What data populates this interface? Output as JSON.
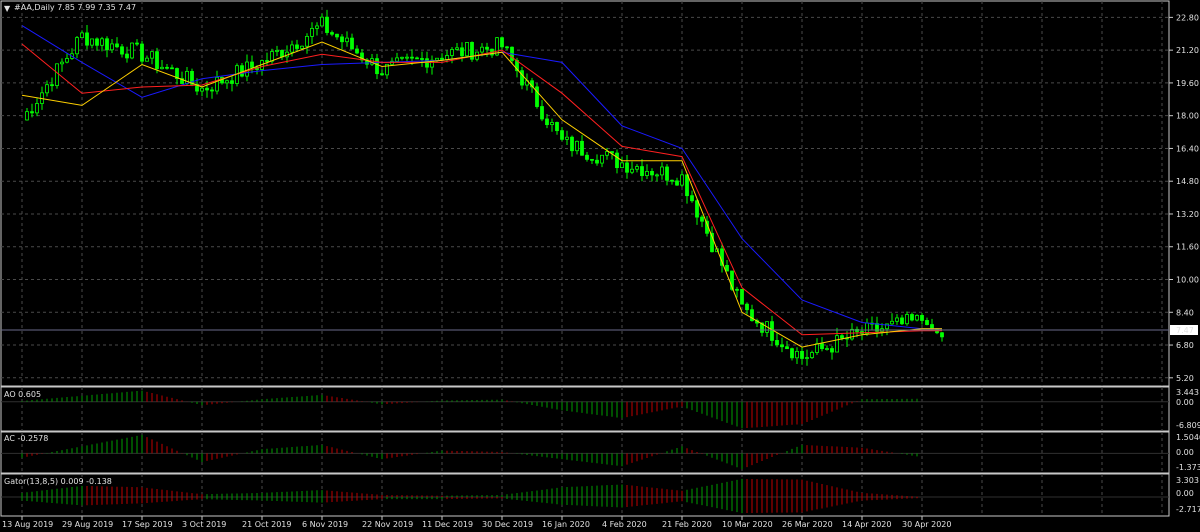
{
  "window": {
    "main_title": "#AA,Daily  7.85 7.99 7.35 7.47",
    "current_price": "7.47",
    "menu_arrow_icon": "triangle-down-icon"
  },
  "colors": {
    "background": "#000000",
    "grid": "#4a4a4a",
    "panel_border": "#c8c8c8",
    "bull": "#00ff00",
    "bear": "#00ff00",
    "jaw": "#1a1aff",
    "teeth": "#ff2020",
    "lips": "#ffd000",
    "ind_up": "#00a000",
    "ind_down": "#c00000",
    "text": "#e0e0e0"
  },
  "x_axis": {
    "labels": [
      "13 Aug 2019",
      "29 Aug 2019",
      "17 Sep 2019",
      "3 Oct 2019",
      "21 Oct 2019",
      "6 Nov 2019",
      "22 Nov 2019",
      "11 Dec 2019",
      "30 Dec 2019",
      "16 Jan 2020",
      "4 Feb 2020",
      "21 Feb 2020",
      "10 Mar 2020",
      "26 Mar 2020",
      "14 Apr 2020",
      "30 Apr 2020"
    ]
  },
  "main_panel": {
    "y_ticks": [
      "22.80",
      "21.20",
      "19.60",
      "18.00",
      "16.40",
      "14.80",
      "13.20",
      "11.60",
      "10.00",
      "8.40",
      "6.80",
      "5.20"
    ]
  },
  "ao_panel": {
    "title": "AO 0.605",
    "y_ticks": [
      "3.443",
      "0.00",
      "-6.809"
    ]
  },
  "ac_panel": {
    "title": "AC -0.2578",
    "y_ticks": [
      "1.5046",
      "0.00",
      "-1.3736"
    ]
  },
  "gator_panel": {
    "title": "Gator(13,8,5) 0.009 -0.138",
    "y_ticks": [
      "3.303",
      "0.00",
      "-2.717"
    ]
  },
  "chart_data": {
    "type": "line",
    "symbol": "#AA",
    "timeframe": "Daily",
    "last_bar": {
      "open": 7.85,
      "high": 7.99,
      "low": 7.35,
      "close": 7.47
    },
    "ylim": [
      4.8,
      23.6
    ],
    "x": [
      "13 Aug 2019",
      "29 Aug 2019",
      "17 Sep 2019",
      "3 Oct 2019",
      "21 Oct 2019",
      "6 Nov 2019",
      "22 Nov 2019",
      "11 Dec 2019",
      "30 Dec 2019",
      "16 Jan 2020",
      "4 Feb 2020",
      "21 Feb 2020",
      "10 Mar 2020",
      "26 Mar 2020",
      "14 Apr 2020",
      "30 Apr 2020"
    ],
    "series": [
      {
        "name": "Close",
        "values": [
          17.8,
          21.9,
          21.0,
          19.3,
          20.6,
          22.4,
          20.2,
          21.0,
          21.4,
          16.7,
          15.7,
          15.0,
          8.6,
          6.2,
          7.4,
          8.0
        ]
      },
      {
        "name": "Jaw",
        "values": [
          22.4,
          20.6,
          18.9,
          19.8,
          20.2,
          20.5,
          20.6,
          20.7,
          21.1,
          20.6,
          17.5,
          16.4,
          12.0,
          9.0,
          7.9,
          7.6
        ]
      },
      {
        "name": "Teeth",
        "values": [
          21.5,
          19.1,
          19.4,
          19.5,
          20.4,
          21.0,
          20.6,
          20.6,
          21.2,
          19.1,
          16.5,
          16.0,
          9.6,
          7.3,
          7.4,
          7.5
        ]
      },
      {
        "name": "Lips",
        "values": [
          19.0,
          18.5,
          20.5,
          19.4,
          20.5,
          21.6,
          20.4,
          20.7,
          21.1,
          17.8,
          15.8,
          15.8,
          8.4,
          6.7,
          7.3,
          7.6
        ]
      }
    ],
    "indicators": [
      {
        "title": "AO 0.605",
        "ylim": [
          -6.809,
          3.443
        ],
        "values": [
          0.2,
          1.4,
          2.6,
          -0.8,
          0.6,
          1.6,
          -0.6,
          0.3,
          0.5,
          -2.0,
          -3.8,
          -1.1,
          -6.2,
          -5.2,
          0.6,
          0.7
        ]
      },
      {
        "title": "AC -0.2578",
        "ylim": [
          -1.3736,
          1.5046
        ],
        "values": [
          -0.3,
          0.5,
          1.3,
          -0.6,
          0.3,
          0.6,
          -0.4,
          0.2,
          0.1,
          -0.4,
          -0.9,
          0.5,
          -1.1,
          0.6,
          0.4,
          -0.26
        ]
      },
      {
        "title": "Gator(13,8,5) 0.009 -0.138",
        "ylim": [
          -2.717,
          3.303
        ],
        "upper": [
          0.6,
          1.6,
          1.4,
          0.4,
          0.6,
          1.0,
          0.3,
          0.2,
          0.3,
          1.4,
          1.8,
          0.9,
          2.6,
          2.5,
          0.6,
          0.01
        ],
        "lower": [
          -0.5,
          -1.2,
          -0.9,
          -0.3,
          -0.5,
          -0.8,
          -0.3,
          -0.3,
          -0.2,
          -1.1,
          -1.5,
          -0.6,
          -2.3,
          -2.2,
          -0.5,
          -0.14
        ]
      }
    ]
  }
}
